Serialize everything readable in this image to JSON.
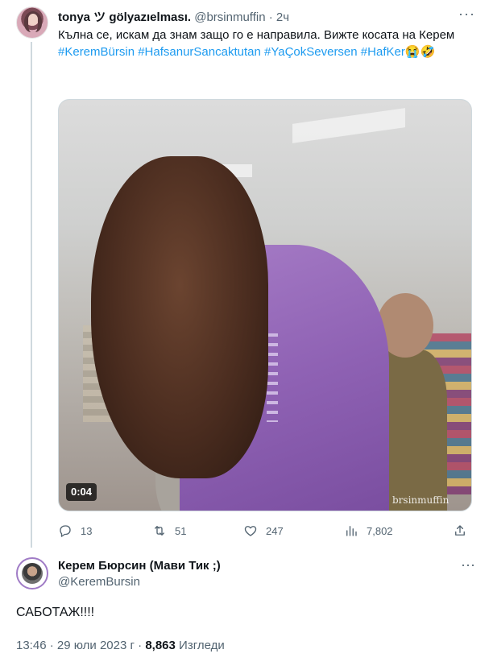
{
  "tweet": {
    "author_name": "tonya ツ gölyazıelması.",
    "author_handle": "@brsinmuffin",
    "separator": "·",
    "time_ago": "2ч",
    "text": "Кълна се, искам да знам защо го е направила. Вижте косата на Керем",
    "hashtags": [
      "#KeremBürsin",
      "#HafsanurSancaktutan",
      "#YaÇokSeversen",
      "#HafKer"
    ],
    "emoji": "😭🤣",
    "video_duration": "0:04",
    "watermark": "brsinmuffin",
    "stats": {
      "replies": "13",
      "retweets": "51",
      "likes": "247",
      "views": "7,802"
    },
    "icons": [
      "reply-icon",
      "retweet-icon",
      "like-icon",
      "views-icon",
      "share-icon",
      "more-icon"
    ]
  },
  "reply": {
    "author_name": "Керем Бюрсин (Мави Тик ;)",
    "author_handle": "@KeremBursin",
    "text": "САБОТАЖ!!!!",
    "time": "13:46",
    "separator": "·",
    "date": "29 юли 2023 г",
    "views_count": "8,863",
    "views_label": "Изгледи"
  },
  "colors": {
    "text": "#0f1419",
    "secondary": "#536471",
    "link": "#1d9bf0",
    "border": "#cfd9de"
  }
}
